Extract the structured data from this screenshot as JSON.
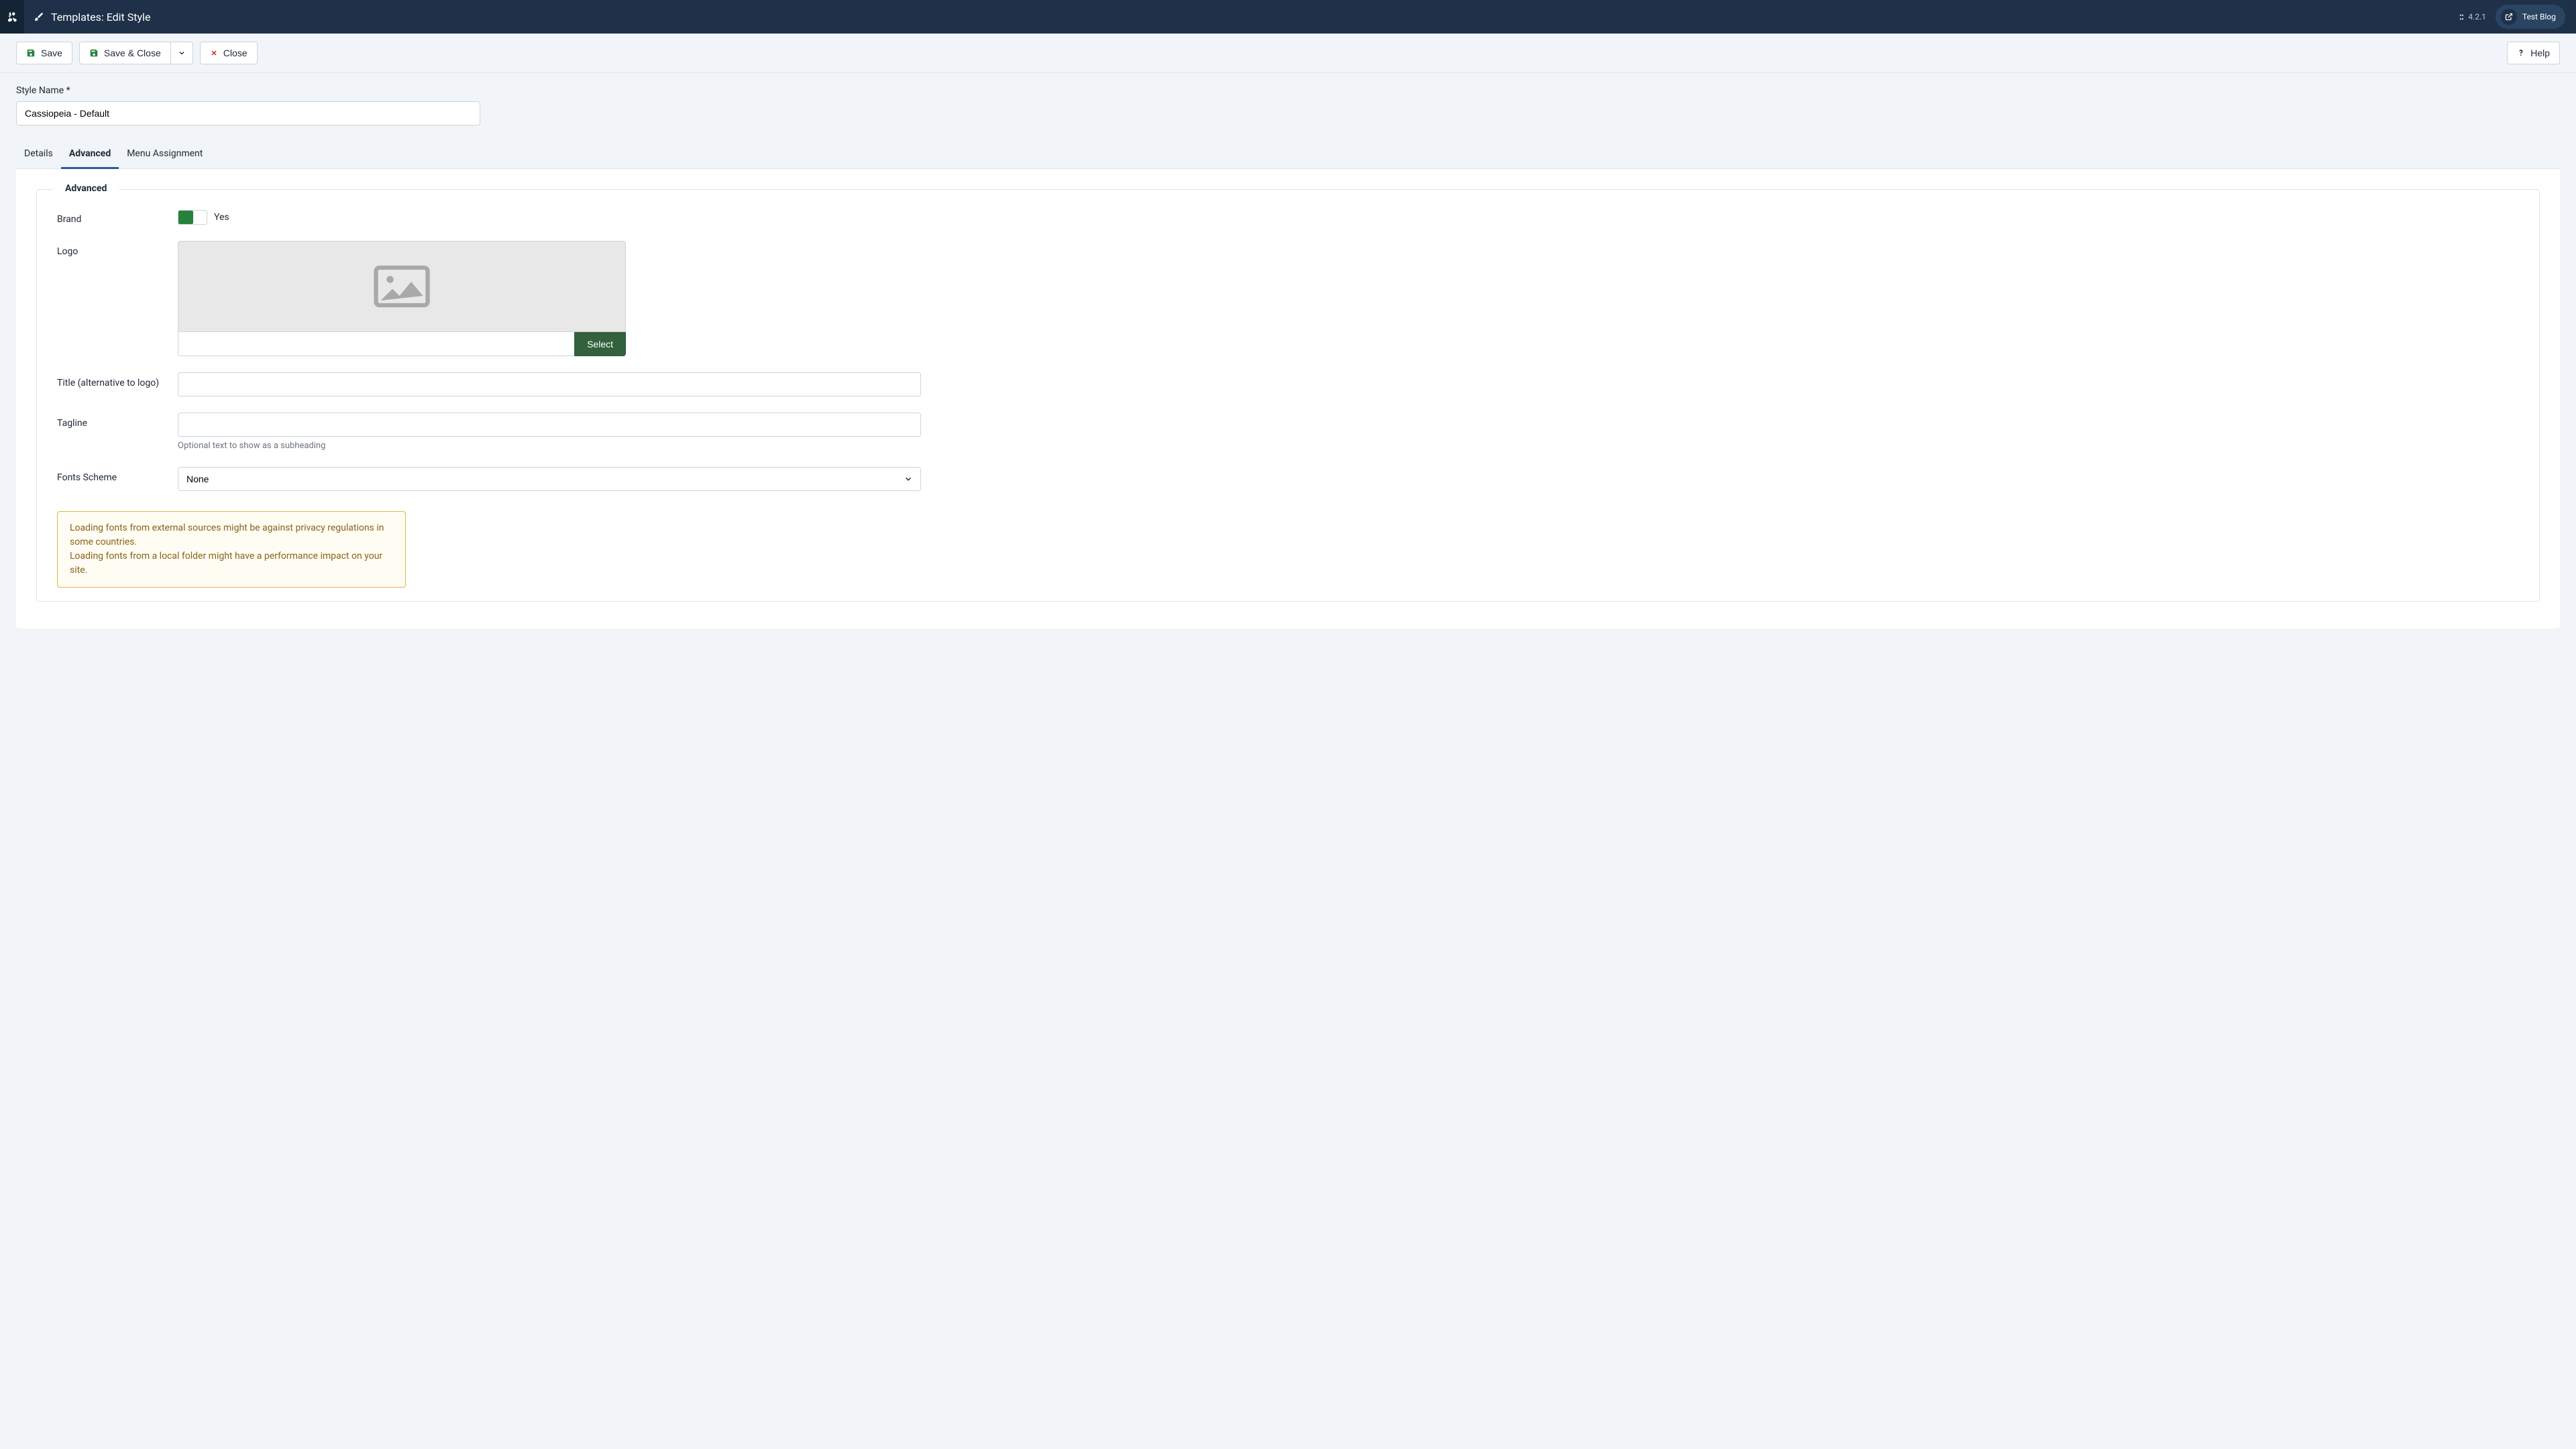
{
  "header": {
    "title": "Templates: Edit Style",
    "version": "4.2.1",
    "site_label": "Test Blog"
  },
  "toolbar": {
    "save": "Save",
    "save_close": "Save & Close",
    "close": "Close",
    "help": "Help"
  },
  "form": {
    "style_name_label": "Style Name *",
    "style_name_value": "Cassiopeia - Default"
  },
  "tabs": {
    "details": "Details",
    "advanced": "Advanced",
    "menu_assignment": "Menu Assignment"
  },
  "advanced": {
    "legend": "Advanced",
    "brand": {
      "label": "Brand",
      "value_label": "Yes"
    },
    "logo": {
      "label": "Logo",
      "path": "",
      "select": "Select"
    },
    "title": {
      "label": "Title (alternative to logo)",
      "value": ""
    },
    "tagline": {
      "label": "Tagline",
      "value": "",
      "helper": "Optional text to show as a subheading"
    },
    "fonts_scheme": {
      "label": "Fonts Scheme",
      "selected": "None"
    },
    "warning_line1": "Loading fonts from external sources might be against privacy regulations in some countries.",
    "warning_line2": "Loading fonts from a local folder might have a performance impact on your site."
  }
}
